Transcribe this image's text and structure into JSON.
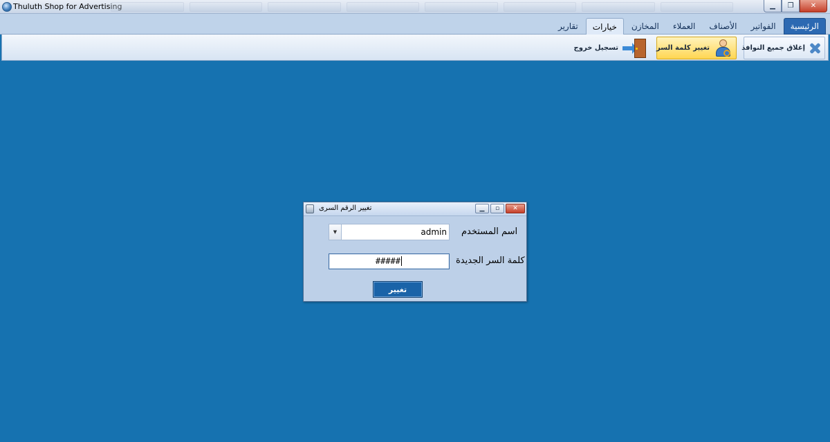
{
  "window": {
    "title": "Thuluth Shop for Advertising",
    "controls": {
      "minimize": "▁",
      "maximize": "❐",
      "close": "✕"
    }
  },
  "ribbon": {
    "tabs": [
      {
        "label": "الرئيسية",
        "state": "home"
      },
      {
        "label": "الفواتير",
        "state": ""
      },
      {
        "label": "الأصناف",
        "state": ""
      },
      {
        "label": "العملاء",
        "state": ""
      },
      {
        "label": "المخازن",
        "state": ""
      },
      {
        "label": "خيارات",
        "state": "active"
      },
      {
        "label": "تقارير",
        "state": ""
      }
    ],
    "buttons": {
      "close_all": {
        "label": "إغلاق جميع النوافذ",
        "icon": "close-x-icon"
      },
      "change_password": {
        "label": "تغيير كلمة السر",
        "icon": "user-key-icon"
      },
      "logout": {
        "label": "تسجيل خروج",
        "icon": "door-exit-icon"
      }
    }
  },
  "dialog": {
    "title": "تغيير الرقم السرى",
    "controls": {
      "minimize": "▁",
      "maximize": "▫",
      "close": "✕"
    },
    "username_label": "اسم المستخدم",
    "username_value": "admin",
    "dropdown_arrow": "▼",
    "password_label": "كلمة السر الجديدة",
    "password_value": "#####",
    "submit_label": "تغيير"
  },
  "colors": {
    "desktop_background": "#1672b0",
    "ribbon_highlight": "#ffd652",
    "home_tab": "#2c69b2",
    "submit_button": "#1a63a8"
  }
}
